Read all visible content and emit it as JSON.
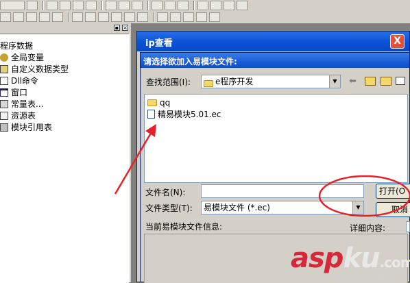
{
  "left_panel": {
    "root_label": "程序数据",
    "items": [
      {
        "label": "全局变量",
        "icon": "globe-icon"
      },
      {
        "label": "自定义数据类型",
        "icon": "type-icon"
      },
      {
        "label": "Dll命令",
        "icon": "dll-icon"
      },
      {
        "label": "窗口",
        "icon": "window-icon"
      },
      {
        "label": "常量表...",
        "icon": "constant-icon"
      },
      {
        "label": "资源表",
        "icon": "resource-icon"
      },
      {
        "label": "模块引用表",
        "icon": "module-icon"
      }
    ]
  },
  "outer_window": {
    "title": "ip查看",
    "close_label": "X"
  },
  "dialog": {
    "title": "请选择欲加入易模块文件:",
    "look_in_label": "查找范围(I):",
    "look_in_value": "e程序开发",
    "files": [
      {
        "name": "qq",
        "type": "folder"
      },
      {
        "name": "精易模块5.01.ec",
        "type": "ec-file"
      }
    ],
    "filename_label": "文件名(N):",
    "filename_value": "",
    "filetype_label": "文件类型(T):",
    "filetype_value": "易模块文件 (*.ec)",
    "open_button": "打开(O",
    "cancel_button": "取消",
    "info_label": "当前易模块文件信息:",
    "detail_label": "详细内容:"
  },
  "watermark": {
    "brand_red": "asp",
    "brand_white": "ku",
    "brand_com": ".com",
    "tagline": "免费网站源码下载站"
  },
  "colors": {
    "title_blue": "#0a55d8",
    "annotation_red": "#e8202a",
    "panel_gray": "#d4d0c8"
  }
}
